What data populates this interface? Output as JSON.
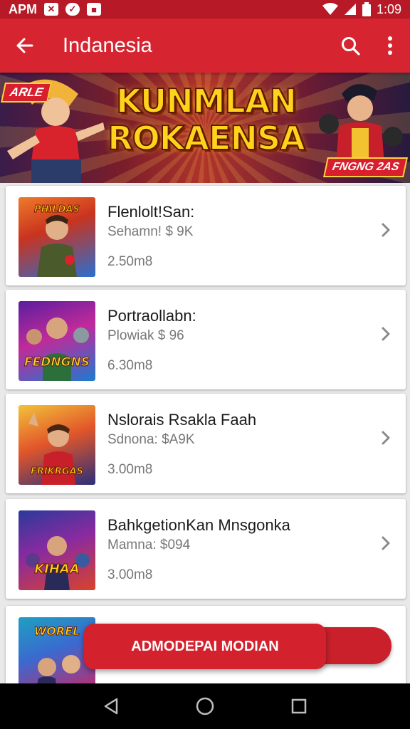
{
  "status_bar": {
    "carrier": "APM",
    "time": "1:09",
    "icons": [
      "x-box-icon",
      "shield-icon",
      "square-icon",
      "wifi-icon",
      "signal-icon",
      "battery-icon"
    ]
  },
  "app_bar": {
    "title": "Indanesia",
    "back_icon": "arrow-left-icon",
    "search_icon": "search-icon",
    "menu_icon": "more-vertical-icon"
  },
  "banner": {
    "title_line1": "KUNMLAN",
    "title_line2": "ROKAENSA",
    "tag_left": "ARLE",
    "tag_right": "FNGNG 2AS"
  },
  "items": [
    {
      "title": "Flenlolt!San:",
      "subtitle": "Sehamn! $ 9K",
      "size": "2.50m8",
      "thumb_label": "PHILDAS"
    },
    {
      "title": "Portraollabn:",
      "subtitle": "Plowiak $ 96",
      "size": "6.30m8",
      "thumb_label": "FEDNGNS"
    },
    {
      "title": "Nslorais Rsakla Faah",
      "subtitle": "Sdnona: $A9K",
      "size": "3.00m8",
      "thumb_label": "FRIKRGAS"
    },
    {
      "title": "BahkgetionKan Mnsgonka",
      "subtitle": "Mamna: $094",
      "size": "3.00m8",
      "thumb_label": "KIHAA"
    },
    {
      "title": "",
      "subtitle": "",
      "size": "",
      "thumb_label": "WOREL"
    }
  ],
  "fab": {
    "label": "ADMODEPAI MODIAN"
  },
  "nav_bar": {
    "back_icon": "triangle-back-icon",
    "home_icon": "circle-home-icon",
    "recents_icon": "square-recents-icon"
  },
  "colors": {
    "primary": "#d62530",
    "status_bar": "#b71a26",
    "card_bg": "#ffffff",
    "list_bg": "#e9e9e9"
  }
}
